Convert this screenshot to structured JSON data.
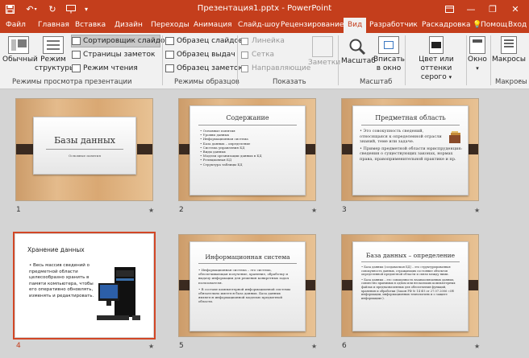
{
  "window": {
    "title": "Презентация1.pptx - PowerPoint",
    "qa_icons": [
      "save-icon",
      "undo-icon",
      "redo-icon",
      "present-icon",
      "customize-icon"
    ],
    "controls": [
      "ribbon-display-icon",
      "minimize-icon",
      "restore-icon",
      "close-icon"
    ]
  },
  "tabs": [
    "Файл",
    "Главная",
    "Вставка",
    "Дизайн",
    "Переходы",
    "Анимация",
    "Слайд-шоу",
    "Рецензирование",
    "Вид",
    "Разработчик",
    "Раскадровка"
  ],
  "active_tab": "Вид",
  "help": "Помощ",
  "signin": "Вход",
  "ribbon": {
    "views": {
      "normal": "Обычный",
      "outline1": "Режим",
      "outline2": "структуры",
      "sorter": "Сортировщик слайдов",
      "notes": "Страницы заметок",
      "reading": "Режим чтения",
      "group": "Режимы просмотра презентации"
    },
    "masters": {
      "slide": "Образец слайдов",
      "handout": "Образец выдач",
      "notes": "Образец заметок",
      "group": "Режимы образцов"
    },
    "show": {
      "ruler": "Линейка",
      "grid": "Сетка",
      "guides": "Направляющие",
      "notes_btn": "Заметки",
      "group": "Показать"
    },
    "zoom": {
      "zoom": "Масштаб",
      "fit1": "Вписать",
      "fit2": "в окно",
      "group": "Масштаб"
    },
    "color": {
      "l1": "Цвет или оттенки",
      "l2": "серого"
    },
    "window_btn": "Окно",
    "macros": {
      "label": "Макросы",
      "group": "Макросы"
    }
  },
  "slides": [
    {
      "num": "1",
      "title": "Базы данных",
      "subtitle": "Основные понятия"
    },
    {
      "num": "2",
      "title": "Содержание",
      "items": [
        "Основные понятия",
        "Уровни данных",
        "Информационная система",
        "База данных – определение",
        "Система управления БД",
        "Виды данных",
        "Модели организации данных в БД",
        "Реляционная БД",
        "Структура таблицы БД"
      ]
    },
    {
      "num": "3",
      "title": "Предметная область",
      "items": [
        "Это совокупность сведений, относящаяся к определенной отрасли знаний, теме или задаче.",
        "Пример предметной области юриспруденция: сведения о существующих законах, нормах права, правоприменительной практике и пр."
      ]
    },
    {
      "num": "4",
      "title": "Хранение данных",
      "text": "Весь массив сведений о предметной области целесообразно хранить в памяти компьютера, чтобы его оперативно обновлять, изменять и редактировать."
    },
    {
      "num": "5",
      "title": "Информационная система",
      "items": [
        "Информационная система – это система, обеспечивающая получение, хранение, обработку и выдачу информации для решения конкретных задач пользователя.",
        "В составе компьютерной информационной системы обязательно имеется база данных. База данных является информационной моделью предметной области."
      ]
    },
    {
      "num": "6",
      "title": "База данных – определение",
      "items": [
        "База данных (создаваемая БД) – это структурированная совокупность данных, отражающих состояние объектов определенной предметной области и связи между ними.",
        "База данных – это совокупность взаимосвязанных данных, совместно хранимых в одном или нескольких компьютерных файлах и предназначенных для обеспечения функций, хранения и обработки (Закон РФ № 14 ФЗ от 27.07.2006 «Об информации, информационных технологиях и о защите информации»)."
      ]
    }
  ],
  "star": "★",
  "colors": {
    "accent": "#c43e1c",
    "selection": "#d24726"
  }
}
